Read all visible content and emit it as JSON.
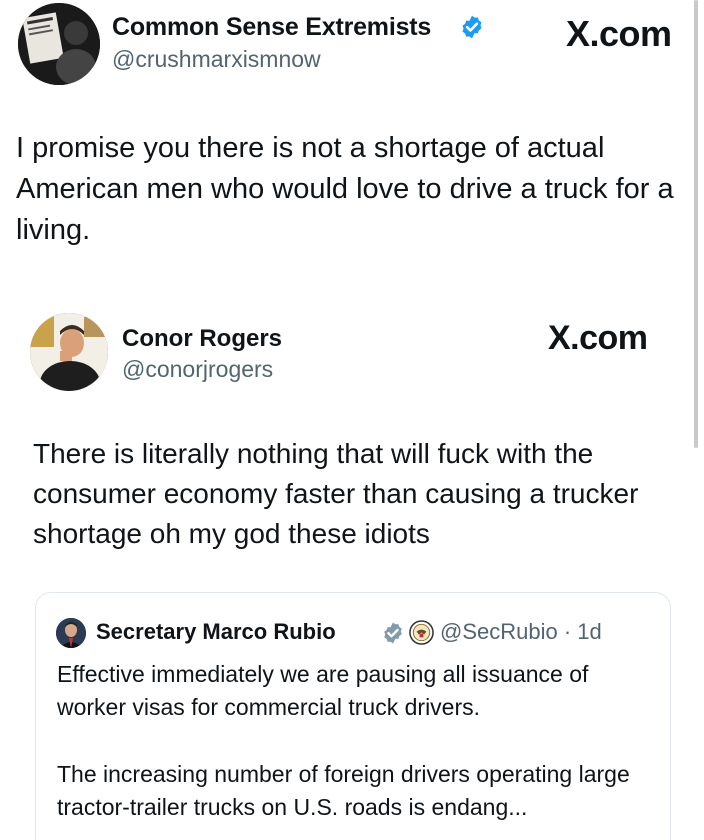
{
  "outer_tweet": {
    "name": "Common Sense Extremists",
    "handle": "@crushmarxismnow",
    "site": "X.com",
    "text": "I promise you there is not a shortage of actual American men who would love to drive a truck for a living."
  },
  "quoted_tweet": {
    "name": "Conor Rogers",
    "handle": "@conorjrogers",
    "site": "X.com",
    "text": "There is literally nothing that will fuck with the consumer economy faster than causing a trucker shortage oh my god these idiots"
  },
  "nested_quote": {
    "name": "Secretary Marco Rubio",
    "handle_time": "@SecRubio · 1d",
    "paragraph1": "Effective immediately we are pausing all issuance of worker visas for commercial truck drivers.",
    "paragraph2": "The increasing number of foreign drivers operating large tractor-trailer trucks on U.S. roads is endang..."
  },
  "colors": {
    "verified_blue": "#1d9bf0",
    "verified_gray": "#829aab",
    "text_primary": "#0f1419",
    "text_secondary": "#536471"
  },
  "icons": [
    "verified-badge-icon",
    "gov-seal-icon"
  ]
}
